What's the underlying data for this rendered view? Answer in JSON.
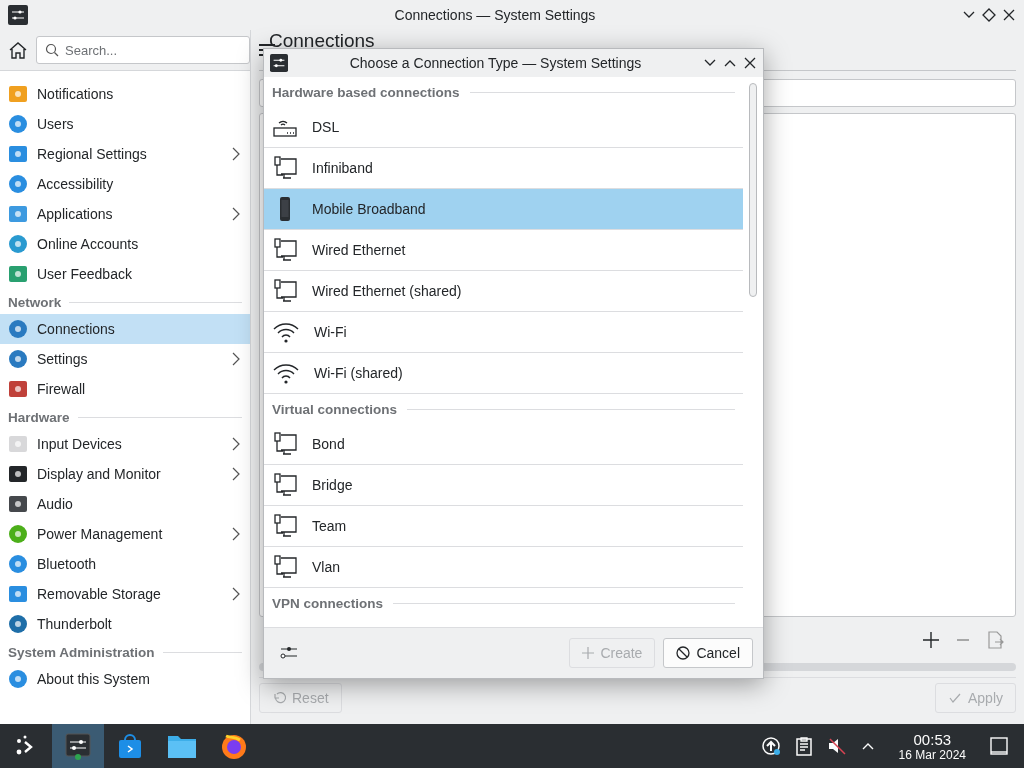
{
  "window": {
    "title": "Connections — System Settings"
  },
  "sidebar": {
    "search": {
      "placeholder": "Search..."
    },
    "groups": [
      {
        "items": [
          {
            "label": "Notifications",
            "has_subpages": false,
            "selected": false
          },
          {
            "label": "Users",
            "has_subpages": false,
            "selected": false
          },
          {
            "label": "Regional Settings",
            "has_subpages": true,
            "selected": false
          },
          {
            "label": "Accessibility",
            "has_subpages": false,
            "selected": false
          },
          {
            "label": "Applications",
            "has_subpages": true,
            "selected": false
          },
          {
            "label": "Online Accounts",
            "has_subpages": false,
            "selected": false
          },
          {
            "label": "User Feedback",
            "has_subpages": false,
            "selected": false
          }
        ]
      },
      {
        "heading": "Network",
        "items": [
          {
            "label": "Connections",
            "has_subpages": false,
            "selected": true
          },
          {
            "label": "Settings",
            "has_subpages": true,
            "selected": false
          },
          {
            "label": "Firewall",
            "has_subpages": false,
            "selected": false
          }
        ]
      },
      {
        "heading": "Hardware",
        "items": [
          {
            "label": "Input Devices",
            "has_subpages": true,
            "selected": false
          },
          {
            "label": "Display and Monitor",
            "has_subpages": true,
            "selected": false
          },
          {
            "label": "Audio",
            "has_subpages": false,
            "selected": false
          },
          {
            "label": "Power Management",
            "has_subpages": true,
            "selected": false
          },
          {
            "label": "Bluetooth",
            "has_subpages": false,
            "selected": false
          },
          {
            "label": "Removable Storage",
            "has_subpages": true,
            "selected": false
          },
          {
            "label": "Thunderbolt",
            "has_subpages": false,
            "selected": false
          }
        ]
      },
      {
        "heading": "System Administration",
        "items": [
          {
            "label": "About this System",
            "has_subpages": false,
            "selected": false
          }
        ]
      }
    ]
  },
  "page": {
    "title": "Connections",
    "reset_button": {
      "label": "Reset",
      "disabled": true
    },
    "apply_button": {
      "label": "Apply",
      "disabled": true
    }
  },
  "dialog": {
    "title": "Choose a Connection Type — System Settings",
    "sections": [
      {
        "heading": "Hardware based connections",
        "items": [
          {
            "label": "DSL",
            "kind": "modem",
            "selected": false
          },
          {
            "label": "Infiniband",
            "kind": "wired",
            "selected": false
          },
          {
            "label": "Mobile Broadband",
            "kind": "mobile",
            "selected": true
          },
          {
            "label": "Wired Ethernet",
            "kind": "wired",
            "selected": false
          },
          {
            "label": "Wired Ethernet (shared)",
            "kind": "wired",
            "selected": false
          },
          {
            "label": "Wi-Fi",
            "kind": "wireless",
            "selected": false
          },
          {
            "label": "Wi-Fi (shared)",
            "kind": "wireless",
            "selected": false
          }
        ]
      },
      {
        "heading": "Virtual connections",
        "items": [
          {
            "label": "Bond",
            "kind": "wired",
            "selected": false
          },
          {
            "label": "Bridge",
            "kind": "wired",
            "selected": false
          },
          {
            "label": "Team",
            "kind": "wired",
            "selected": false
          },
          {
            "label": "Vlan",
            "kind": "wired",
            "selected": false
          }
        ]
      },
      {
        "heading": "VPN connections"
      }
    ],
    "create_button": {
      "label": "Create",
      "disabled": true
    },
    "cancel_button": {
      "label": "Cancel",
      "disabled": false
    }
  },
  "taskbar": {
    "time": "00:53",
    "date": "16 Mar 2024"
  }
}
